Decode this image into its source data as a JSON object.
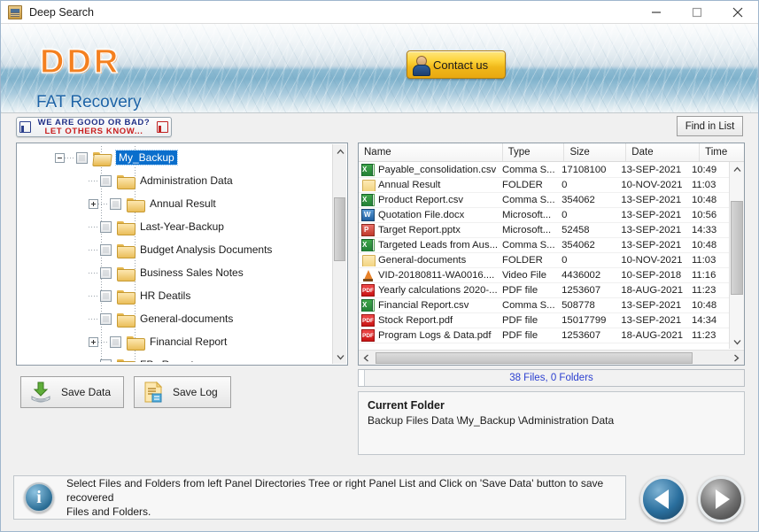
{
  "window": {
    "title": "Deep Search",
    "icon": "app-icon",
    "controls": {
      "minimize": "minimize-icon",
      "maximize": "maximize-icon",
      "close": "close-icon"
    }
  },
  "banner": {
    "logo": "DDR",
    "product": "FAT Recovery",
    "contact_label": "Contact us",
    "contact_icon": "person-icon"
  },
  "toolbar": {
    "rate_line1": "WE ARE GOOD OR BAD?",
    "rate_line2": "LET OTHERS KNOW...",
    "thumb_up_icon": "thumbs-up-icon",
    "thumb_down_icon": "thumbs-down-icon",
    "find_label": "Find in List"
  },
  "tree": {
    "items": [
      {
        "label": "My_Backup",
        "indent": 3,
        "expander": "minus",
        "selected": true,
        "icon": "folder-open-icon"
      },
      {
        "label": "Administration Data",
        "indent": 4,
        "expander": "none",
        "selected": false,
        "icon": "folder-icon"
      },
      {
        "label": "Annual Result",
        "indent": 4,
        "expander": "plus",
        "selected": false,
        "icon": "folder-icon"
      },
      {
        "label": "Last-Year-Backup",
        "indent": 4,
        "expander": "none",
        "selected": false,
        "icon": "folder-icon"
      },
      {
        "label": "Budget Analysis Documents",
        "indent": 4,
        "expander": "none",
        "selected": false,
        "icon": "folder-icon"
      },
      {
        "label": "Business Sales Notes",
        "indent": 4,
        "expander": "none",
        "selected": false,
        "icon": "folder-icon"
      },
      {
        "label": "HR Deatils",
        "indent": 4,
        "expander": "none",
        "selected": false,
        "icon": "folder-icon"
      },
      {
        "label": "General-documents",
        "indent": 4,
        "expander": "none",
        "selected": false,
        "icon": "folder-icon"
      },
      {
        "label": "Financial Report",
        "indent": 4,
        "expander": "plus",
        "selected": false,
        "icon": "folder-icon"
      },
      {
        "label": "FPs Report",
        "indent": 4,
        "expander": "none",
        "selected": false,
        "icon": "folder-icon"
      }
    ]
  },
  "actions": {
    "save_data_label": "Save Data",
    "save_data_icon": "save-drive-icon",
    "save_log_label": "Save Log",
    "save_log_icon": "log-document-icon"
  },
  "file_list": {
    "columns": [
      "Name",
      "Type",
      "Size",
      "Date",
      "Time"
    ],
    "rows": [
      {
        "icon": "excel-file-icon",
        "name": "Payable_consolidation.csv",
        "type": "Comma S...",
        "size": "17108100",
        "date": "13-SEP-2021",
        "time": "10:49"
      },
      {
        "icon": "folder-icon",
        "name": "Annual Result",
        "type": "FOLDER",
        "size": "0",
        "date": "10-NOV-2021",
        "time": "11:03"
      },
      {
        "icon": "excel-file-icon",
        "name": "Product Report.csv",
        "type": "Comma S...",
        "size": "354062",
        "date": "13-SEP-2021",
        "time": "10:48"
      },
      {
        "icon": "word-file-icon",
        "name": "Quotation File.docx",
        "type": "Microsoft...",
        "size": "0",
        "date": "13-SEP-2021",
        "time": "10:56"
      },
      {
        "icon": "powerpoint-file-icon",
        "name": "Target Report.pptx",
        "type": "Microsoft...",
        "size": "52458",
        "date": "13-SEP-2021",
        "time": "14:33"
      },
      {
        "icon": "excel-file-icon",
        "name": "Targeted Leads from Aus...",
        "type": "Comma S...",
        "size": "354062",
        "date": "13-SEP-2021",
        "time": "10:48"
      },
      {
        "icon": "folder-icon",
        "name": "General-documents",
        "type": "FOLDER",
        "size": "0",
        "date": "10-NOV-2021",
        "time": "11:03"
      },
      {
        "icon": "video-file-icon",
        "name": "VID-20180811-WA0016....",
        "type": "Video File",
        "size": "4436002",
        "date": "10-SEP-2018",
        "time": "11:16"
      },
      {
        "icon": "pdf-file-icon",
        "name": "Yearly calculations 2020-...",
        "type": "PDF file",
        "size": "1253607",
        "date": "18-AUG-2021",
        "time": "11:23"
      },
      {
        "icon": "excel-file-icon",
        "name": "Financial Report.csv",
        "type": "Comma S...",
        "size": "508778",
        "date": "13-SEP-2021",
        "time": "10:48"
      },
      {
        "icon": "pdf-file-icon",
        "name": "Stock Report.pdf",
        "type": "PDF file",
        "size": "15017799",
        "date": "13-SEP-2021",
        "time": "14:34"
      },
      {
        "icon": "pdf-file-icon",
        "name": "Program Logs & Data.pdf",
        "type": "PDF file",
        "size": "1253607",
        "date": "18-AUG-2021",
        "time": "11:23"
      }
    ]
  },
  "summary": {
    "count_text": "38 Files, 0 Folders"
  },
  "current_folder": {
    "title": "Current Folder",
    "path": "Backup Files Data \\My_Backup \\Administration Data"
  },
  "status": {
    "icon": "info-icon",
    "line1": "Select Files and Folders from left Panel Directories Tree or right Panel List and Click on 'Save Data' button to save recovered",
    "line2": "Files and Folders."
  },
  "navigation": {
    "back_icon": "back-arrow-icon",
    "forward_icon": "forward-arrow-icon"
  },
  "colors": {
    "accent_orange": "#f48020",
    "product_blue": "#1d63a6",
    "selection_blue": "#0a6ecc",
    "count_blue": "#2b3fd0",
    "rate_blue": "#1f2f86",
    "rate_red": "#c81e1e"
  }
}
